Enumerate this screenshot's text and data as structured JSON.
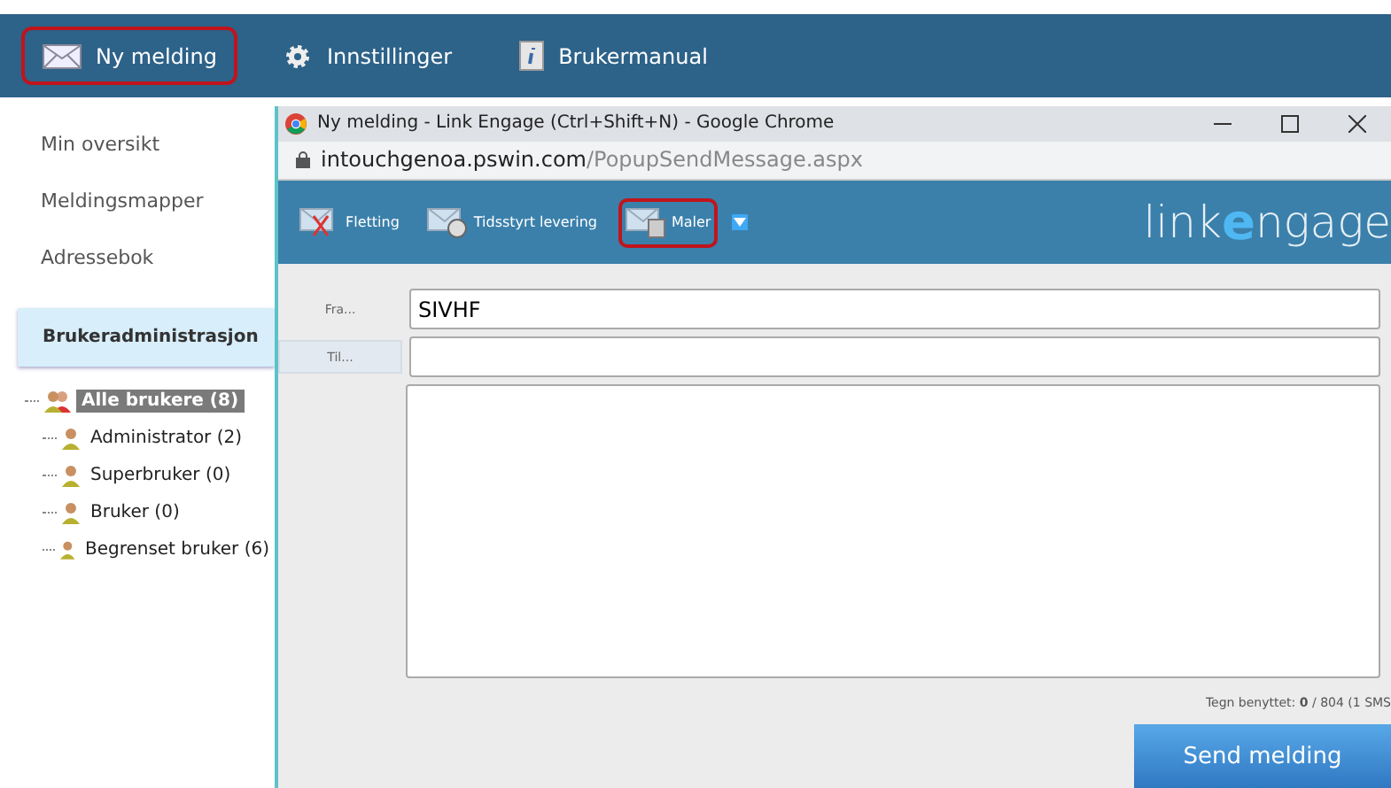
{
  "nav": [
    {
      "label": "Ny melding",
      "highlighted": true
    },
    {
      "label": "Innstillinger",
      "highlighted": false
    },
    {
      "label": "Brukermanual",
      "highlighted": false
    }
  ],
  "sidebar": {
    "items": [
      {
        "label": "Min oversikt",
        "selected": false
      },
      {
        "label": "Meldingsmapper",
        "selected": false
      },
      {
        "label": "Adressebok",
        "selected": false
      },
      {
        "label": "Brukeradministrasjon",
        "selected": true
      }
    ],
    "tree": [
      {
        "label": "Alle brukere (8)",
        "selected": true,
        "children": [
          {
            "label": "Administrator (2)",
            "selected": false
          },
          {
            "label": "Superbruker (0)",
            "selected": false
          },
          {
            "label": "Bruker (0)",
            "selected": false
          },
          {
            "label": "Begrenset bruker (6)",
            "selected": false
          }
        ]
      }
    ]
  },
  "popup": {
    "title": "Ny melding - Link Engage (Ctrl+Shift+N) - Google Chrome",
    "url_host": "intouchgenoa.pswin.com",
    "url_path": "/PopupSendMessage.aspx",
    "toolbar": [
      {
        "label": "Fletting",
        "highlighted": false
      },
      {
        "label": "Tidsstyrt levering",
        "highlighted": false
      },
      {
        "label": "Maler",
        "highlighted": true
      }
    ],
    "logo_left": "link",
    "logo_mark": "e",
    "logo_right": "ngage",
    "fields": [
      {
        "label": "Fra...",
        "value": "SIVHF",
        "button": false
      },
      {
        "label": "Til...",
        "button": true
      }
    ],
    "counter": "Tegn benyttet: **0** / 804 (1 SMS",
    "send": "Send melding"
  }
}
